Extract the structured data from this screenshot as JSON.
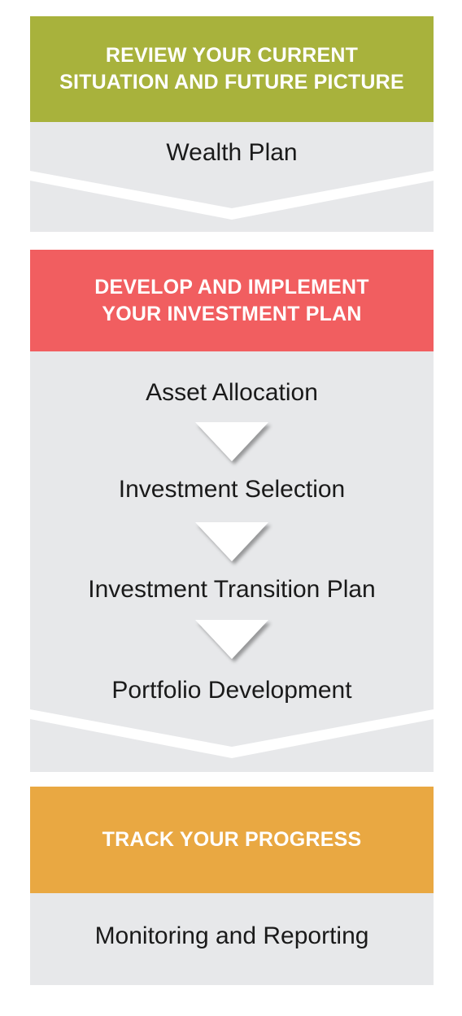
{
  "sections": [
    {
      "header_lines": [
        "REVIEW YOUR CURRENT",
        "SITUATION AND FUTURE PICTURE"
      ],
      "color": "#a8b23c",
      "steps": [
        "Wealth Plan"
      ]
    },
    {
      "header_lines": [
        "DEVELOP AND IMPLEMENT",
        "YOUR INVESTMENT PLAN"
      ],
      "color": "#f15e60",
      "steps": [
        "Asset Allocation",
        "Investment Selection",
        "Investment Transition Plan",
        "Portfolio Development"
      ]
    },
    {
      "header_lines": [
        "TRACK YOUR PROGRESS"
      ],
      "color": "#e9a842",
      "steps": [
        "Monitoring and Reporting"
      ]
    }
  ],
  "panel_color": "#e7e8ea"
}
